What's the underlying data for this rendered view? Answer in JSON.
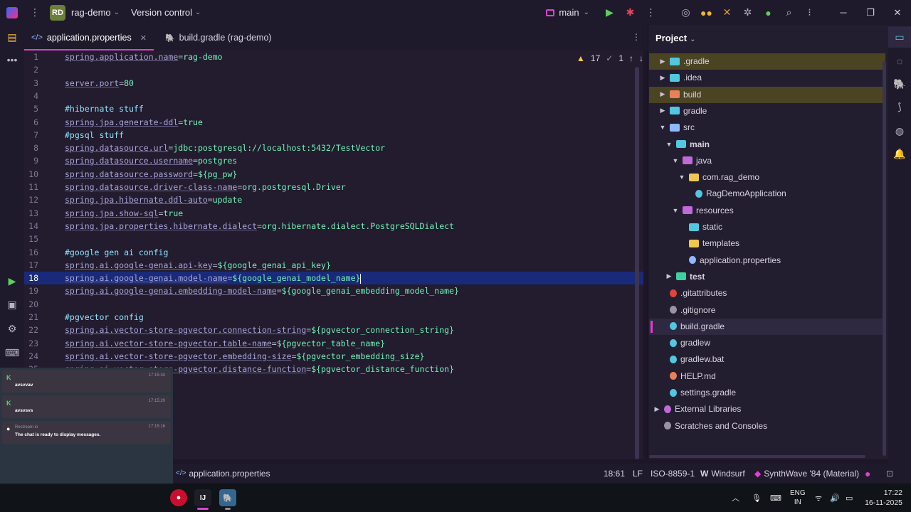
{
  "titlebar": {
    "project_badge": "RD",
    "project_name": "rag-demo",
    "vcs_label": "Version control",
    "branch": "main"
  },
  "tabs": [
    {
      "label": "application.properties",
      "active": true
    },
    {
      "label": "build.gradle (rag-demo)",
      "active": false
    }
  ],
  "inspections": {
    "warnings": "17",
    "weak": "1"
  },
  "editor": {
    "current_line": 18,
    "lines": [
      {
        "n": "1",
        "key": "spring.application.name",
        "val": "rag-demo"
      },
      {
        "n": "2"
      },
      {
        "n": "3",
        "key": "server.port",
        "val": "80"
      },
      {
        "n": "4"
      },
      {
        "n": "5",
        "comment": "#hibernate stuff"
      },
      {
        "n": "6",
        "key": "spring.jpa.generate-ddl",
        "val": "true"
      },
      {
        "n": "7",
        "comment": "#pgsql stuff"
      },
      {
        "n": "8",
        "key": "spring.datasource.url",
        "val": "jdbc:postgresql://localhost:5432/TestVector"
      },
      {
        "n": "9",
        "key": "spring.datasource.username",
        "val": "postgres"
      },
      {
        "n": "10",
        "key": "spring.datasource.password",
        "val": "${pg_pw}"
      },
      {
        "n": "11",
        "key": "spring.datasource.driver-class-name",
        "val": "org.postgresql.Driver"
      },
      {
        "n": "12",
        "key": "spring.jpa.hibernate.ddl-auto",
        "val": "update"
      },
      {
        "n": "13",
        "key": "spring.jpa.show-sql",
        "val": "true"
      },
      {
        "n": "14",
        "key": "spring.jpa.properties.hibernate.dialect",
        "val": "org.hibernate.dialect.PostgreSQLDialect"
      },
      {
        "n": "15"
      },
      {
        "n": "16",
        "comment": "#google gen ai config"
      },
      {
        "n": "17",
        "key": "spring.ai.google-genai.api-key",
        "val": "${google_genai_api_key}"
      },
      {
        "n": "18",
        "key": "spring.ai.google-genai.model-name",
        "val": "${google_genai_model_name}"
      },
      {
        "n": "19",
        "key": "spring.ai.google-genai.embedding-model-name",
        "val": "${google_genai_embedding_model_name}"
      },
      {
        "n": "20"
      },
      {
        "n": "21",
        "comment": "#pgvector config"
      },
      {
        "n": "22",
        "key": "spring.ai.vector-store-pgvector.connection-string",
        "val": "${pgvector_connection_string}"
      },
      {
        "n": "23",
        "key": "spring.ai.vector-store-pgvector.table-name",
        "val": "${pgvector_table_name}"
      },
      {
        "n": "24",
        "key": "spring.ai.vector-store-pgvector.embedding-size",
        "val": "${pgvector_embedding_size}"
      },
      {
        "n": "25",
        "key": "spring.ai.vector-store-pgvector.distance-function",
        "val": "${pgvector_distance_function}"
      }
    ]
  },
  "notifications": [
    {
      "time": "17:15:34",
      "message": "avsvvav",
      "icon_color": "#4fd86c"
    },
    {
      "time": "17:15:20",
      "message": "avsvsvs",
      "icon_color": "#4fd86c"
    },
    {
      "time": "17:15:16",
      "source": "Restream.io",
      "message": "The chat is ready to display messages."
    }
  ],
  "project": {
    "title": "Project",
    "tree": [
      {
        "label": ".gradle",
        "depth": 0,
        "arrow": "▶",
        "icon": "folder-config",
        "highlight": "#4b4422"
      },
      {
        "label": ".idea",
        "depth": 0,
        "arrow": "▶",
        "icon": "folder-config"
      },
      {
        "label": "build",
        "depth": 0,
        "arrow": "▶",
        "icon": "folder-build",
        "highlight": "#4b4422"
      },
      {
        "label": "gradle",
        "depth": 0,
        "arrow": "▶",
        "icon": "folder-config"
      },
      {
        "label": "src",
        "depth": 0,
        "arrow": "▼",
        "icon": "folder-src"
      },
      {
        "label": "main",
        "depth": 1,
        "arrow": "▼",
        "icon": "folder-main",
        "bold": true
      },
      {
        "label": "java",
        "depth": 2,
        "arrow": "▼",
        "icon": "folder-java"
      },
      {
        "label": "com.rag_demo",
        "depth": 3,
        "arrow": "▼",
        "icon": "folder-package"
      },
      {
        "label": "RagDemoApplication",
        "depth": 4,
        "arrow": "",
        "icon": "java-class"
      },
      {
        "label": "resources",
        "depth": 2,
        "arrow": "▼",
        "icon": "folder-resources"
      },
      {
        "label": "static",
        "depth": 3,
        "arrow": "",
        "icon": "folder-static"
      },
      {
        "label": "templates",
        "depth": 3,
        "arrow": "",
        "icon": "folder-templates"
      },
      {
        "label": "application.properties",
        "depth": 3,
        "arrow": "",
        "icon": "properties-file"
      },
      {
        "label": "test",
        "depth": 1,
        "arrow": "▶",
        "icon": "folder-test",
        "bold": true
      },
      {
        "label": ".gitattributes",
        "depth": 0,
        "arrow": "",
        "icon": "git-file"
      },
      {
        "label": ".gitignore",
        "depth": 0,
        "arrow": "",
        "icon": "gitignore-file"
      },
      {
        "label": "build.gradle",
        "depth": 0,
        "arrow": "",
        "icon": "gradle-file",
        "selected": true
      },
      {
        "label": "gradlew",
        "depth": 0,
        "arrow": "",
        "icon": "gradle-file"
      },
      {
        "label": "gradlew.bat",
        "depth": 0,
        "arrow": "",
        "icon": "gradle-file"
      },
      {
        "label": "HELP.md",
        "depth": 0,
        "arrow": "",
        "icon": "markdown-file"
      },
      {
        "label": "settings.gradle",
        "depth": 0,
        "arrow": "",
        "icon": "gradle-file"
      },
      {
        "label": "External Libraries",
        "depth": -1,
        "arrow": "▶",
        "icon": "library"
      },
      {
        "label": "Scratches and Consoles",
        "depth": -1,
        "arrow": "",
        "icon": "scratches"
      }
    ]
  },
  "statusbar": {
    "file": "application.properties",
    "position": "18:61",
    "line_sep": "LF",
    "encoding": "ISO-8859-1",
    "plugin": "Windsurf",
    "theme": "SynthWave '84 (Material)"
  },
  "taskbar": {
    "lang_top": "ENG",
    "lang_bottom": "IN",
    "time": "17:22",
    "date": "16-11-2025"
  },
  "colors": {
    "accent": "#e03fd0",
    "key": "#a8a4d8",
    "value": "#72f1b8",
    "comment": "#8fe3ff",
    "current_line": "#1a2a7a"
  }
}
